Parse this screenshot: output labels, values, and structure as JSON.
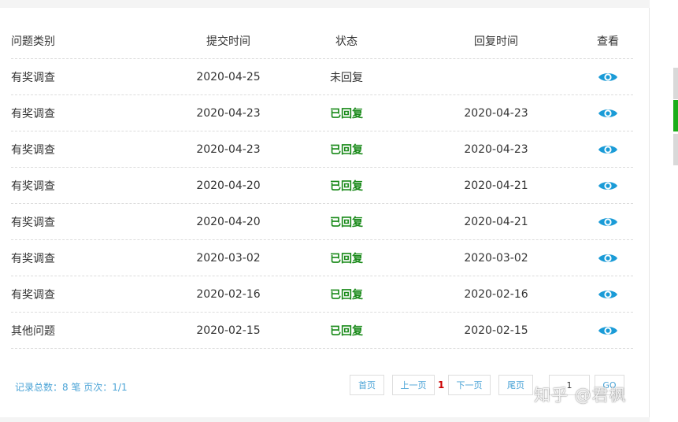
{
  "table": {
    "headers": {
      "category": "问题类别",
      "submitted": "提交时间",
      "status": "状态",
      "replied": "回复时间",
      "view": "查看"
    },
    "rows": [
      {
        "category": "有奖调查",
        "submitted": "2020-04-25",
        "status": "未回复",
        "status_type": "pending",
        "replied": ""
      },
      {
        "category": "有奖调查",
        "submitted": "2020-04-23",
        "status": "已回复",
        "status_type": "replied",
        "replied": "2020-04-23"
      },
      {
        "category": "有奖调查",
        "submitted": "2020-04-23",
        "status": "已回复",
        "status_type": "replied",
        "replied": "2020-04-23"
      },
      {
        "category": "有奖调查",
        "submitted": "2020-04-20",
        "status": "已回复",
        "status_type": "replied",
        "replied": "2020-04-21"
      },
      {
        "category": "有奖调查",
        "submitted": "2020-04-20",
        "status": "已回复",
        "status_type": "replied",
        "replied": "2020-04-21"
      },
      {
        "category": "有奖调查",
        "submitted": "2020-03-02",
        "status": "已回复",
        "status_type": "replied",
        "replied": "2020-03-02"
      },
      {
        "category": "有奖调查",
        "submitted": "2020-02-16",
        "status": "已回复",
        "status_type": "replied",
        "replied": "2020-02-16"
      },
      {
        "category": "其他问题",
        "submitted": "2020-02-15",
        "status": "已回复",
        "status_type": "replied",
        "replied": "2020-02-15"
      }
    ],
    "view_icon": "eye-icon"
  },
  "footer": {
    "summary": "记录总数：8 笔 页次：1/1"
  },
  "pagination": {
    "first": "首页",
    "prev": "上一页",
    "current": "1",
    "next": "下一页",
    "last": "尾页",
    "page_input_value": "1",
    "go": "GO"
  },
  "watermark": "知乎 @君枫",
  "colors": {
    "replied": "#1a8a1a",
    "accent": "#4aa3d6",
    "eye": "#1a9bd7",
    "current_page": "#cc0000"
  }
}
